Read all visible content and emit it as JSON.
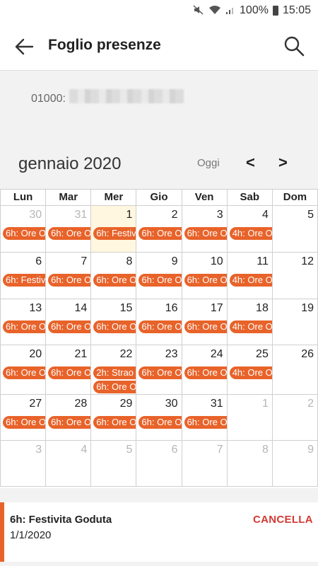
{
  "status_bar": {
    "battery": "100%",
    "time": "15:05"
  },
  "app_bar": {
    "title": "Foglio presenze"
  },
  "employee": {
    "code": "01000:"
  },
  "month": {
    "title": "gennaio 2020",
    "today_label": "Oggi",
    "prev_label": "<",
    "next_label": ">"
  },
  "calendar": {
    "weekdays": [
      "Lun",
      "Mar",
      "Mer",
      "Gio",
      "Ven",
      "Sab",
      "Dom"
    ],
    "weeks": [
      [
        {
          "day": "30",
          "muted": true,
          "events": [
            "6h: Ore O"
          ]
        },
        {
          "day": "31",
          "muted": true,
          "events": [
            "6h: Ore O"
          ]
        },
        {
          "day": "1",
          "today": true,
          "events": [
            "6h: Festiv"
          ]
        },
        {
          "day": "2",
          "events": [
            "6h: Ore O"
          ]
        },
        {
          "day": "3",
          "events": [
            "6h: Ore O"
          ]
        },
        {
          "day": "4",
          "events": [
            "4h: Ore O"
          ]
        },
        {
          "day": "5",
          "events": []
        }
      ],
      [
        {
          "day": "6",
          "events": [
            "6h: Festiv"
          ]
        },
        {
          "day": "7",
          "events": [
            "6h: Ore O"
          ]
        },
        {
          "day": "8",
          "events": [
            "6h: Ore O"
          ]
        },
        {
          "day": "9",
          "events": [
            "6h: Ore O"
          ]
        },
        {
          "day": "10",
          "events": [
            "6h: Ore O"
          ]
        },
        {
          "day": "11",
          "events": [
            "4h: Ore O"
          ]
        },
        {
          "day": "12",
          "events": []
        }
      ],
      [
        {
          "day": "13",
          "events": [
            "6h: Ore O"
          ]
        },
        {
          "day": "14",
          "events": [
            "6h: Ore O"
          ]
        },
        {
          "day": "15",
          "events": [
            "6h: Ore O"
          ]
        },
        {
          "day": "16",
          "events": [
            "6h: Ore O"
          ]
        },
        {
          "day": "17",
          "events": [
            "6h: Ore O"
          ]
        },
        {
          "day": "18",
          "events": [
            "4h: Ore O"
          ]
        },
        {
          "day": "19",
          "events": []
        }
      ],
      [
        {
          "day": "20",
          "events": [
            "6h: Ore O"
          ]
        },
        {
          "day": "21",
          "events": [
            "6h: Ore O"
          ]
        },
        {
          "day": "22",
          "events": [
            "2h: Strao",
            "6h: Ore O"
          ]
        },
        {
          "day": "23",
          "events": [
            "6h: Ore O"
          ]
        },
        {
          "day": "24",
          "events": [
            "6h: Ore O"
          ]
        },
        {
          "day": "25",
          "events": [
            "4h: Ore O"
          ]
        },
        {
          "day": "26",
          "events": []
        }
      ],
      [
        {
          "day": "27",
          "events": [
            "6h: Ore O"
          ]
        },
        {
          "day": "28",
          "events": [
            "6h: Ore O"
          ]
        },
        {
          "day": "29",
          "events": [
            "6h: Ore O"
          ]
        },
        {
          "day": "30",
          "events": [
            "6h: Ore O"
          ]
        },
        {
          "day": "31",
          "events": [
            "6h: Ore O"
          ]
        },
        {
          "day": "1",
          "muted": true,
          "events": []
        },
        {
          "day": "2",
          "muted": true,
          "events": []
        }
      ],
      [
        {
          "day": "3",
          "muted": true,
          "events": []
        },
        {
          "day": "4",
          "muted": true,
          "events": []
        },
        {
          "day": "5",
          "muted": true,
          "events": []
        },
        {
          "day": "6",
          "muted": true,
          "events": []
        },
        {
          "day": "7",
          "muted": true,
          "events": []
        },
        {
          "day": "8",
          "muted": true,
          "events": []
        },
        {
          "day": "9",
          "muted": true,
          "events": []
        }
      ]
    ]
  },
  "detail": {
    "title": "6h: Festivita Goduta",
    "date": "1/1/2020",
    "cancel_label": "CANCELLA"
  },
  "colors": {
    "accent": "#e8632a",
    "today_bg": "#fff7df",
    "cancel": "#d23a35"
  },
  "icons": [
    "mute-icon",
    "wifi-icon",
    "signal-icon",
    "battery-icon",
    "back-arrow-icon",
    "search-icon"
  ]
}
